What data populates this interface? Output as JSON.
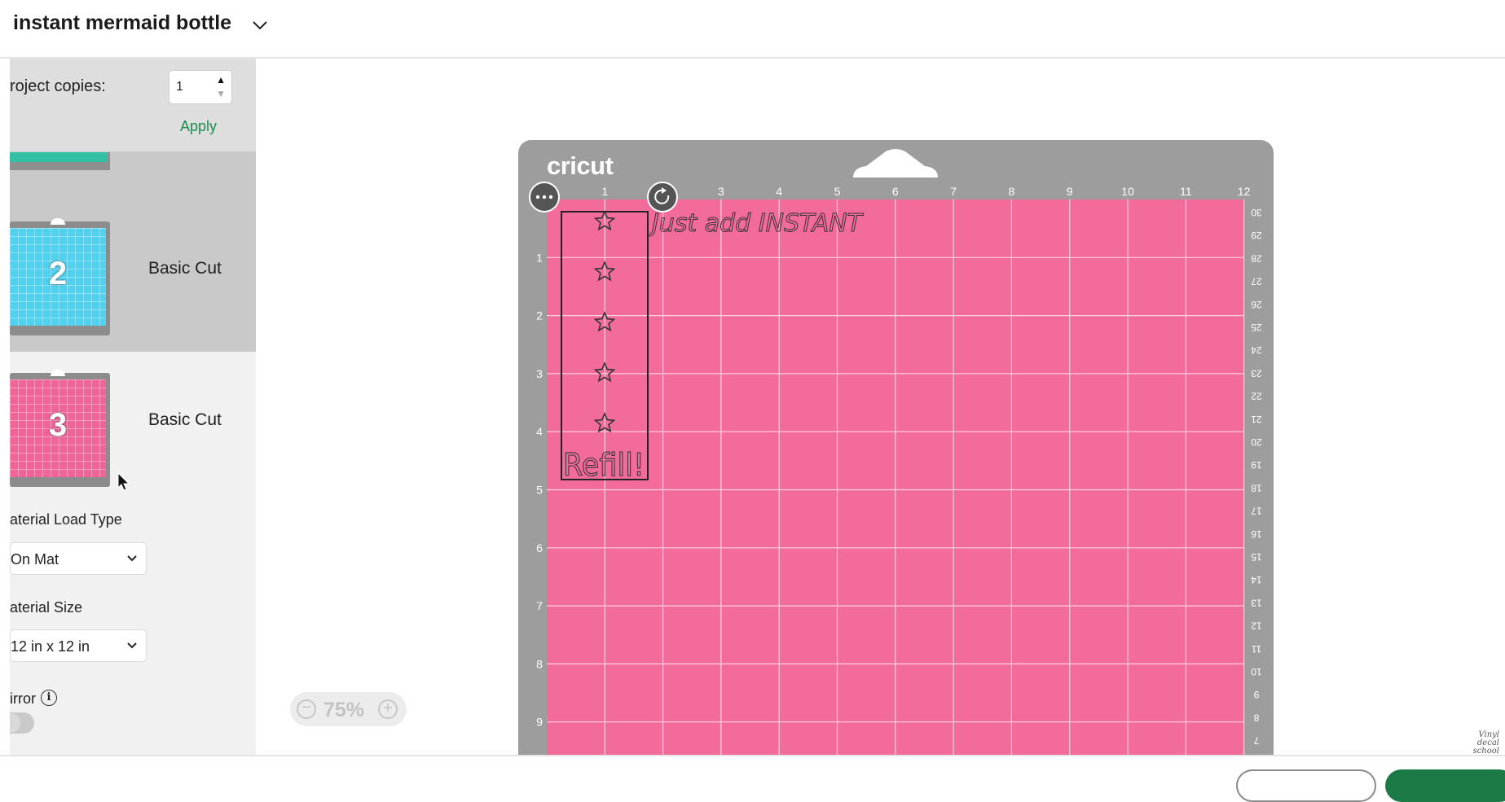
{
  "header": {
    "project_title": "instant mermaid bottle"
  },
  "sidebar": {
    "copies_label": "roject copies:",
    "copies_value": "1",
    "apply_label": "Apply",
    "mats": [
      {
        "number": "2",
        "label": "Basic Cut",
        "color": "#4fd1f0"
      },
      {
        "number": "3",
        "label": "Basic Cut",
        "color": "#f0649a"
      }
    ],
    "load_type_label": "aterial Load Type",
    "load_type_value": "On Mat",
    "size_label": "aterial Size",
    "size_value": "12 in x 12 in",
    "mirror_label": "irror",
    "mirror_on": false
  },
  "mat": {
    "brand": "cricut",
    "surface_color": "#f36b9b",
    "top_ruler": [
      "1",
      "2",
      "3",
      "4",
      "5",
      "6",
      "7",
      "8",
      "9",
      "10",
      "11",
      "12"
    ],
    "left_ruler": [
      "1",
      "2",
      "3",
      "4",
      "5",
      "6",
      "7",
      "8",
      "9"
    ],
    "right_ruler": [
      "30",
      "29",
      "28",
      "27",
      "26",
      "25",
      "24",
      "23",
      "22",
      "21",
      "20",
      "19",
      "18",
      "17",
      "16",
      "15",
      "14",
      "13",
      "12",
      "11",
      "10",
      "9",
      "8",
      "7"
    ],
    "design_text_top": "Just add INSTANT",
    "design_text_bottom": "Refill!"
  },
  "zoom": {
    "value": "75%"
  },
  "watermark": [
    "Vinyl",
    "decal",
    "school"
  ]
}
